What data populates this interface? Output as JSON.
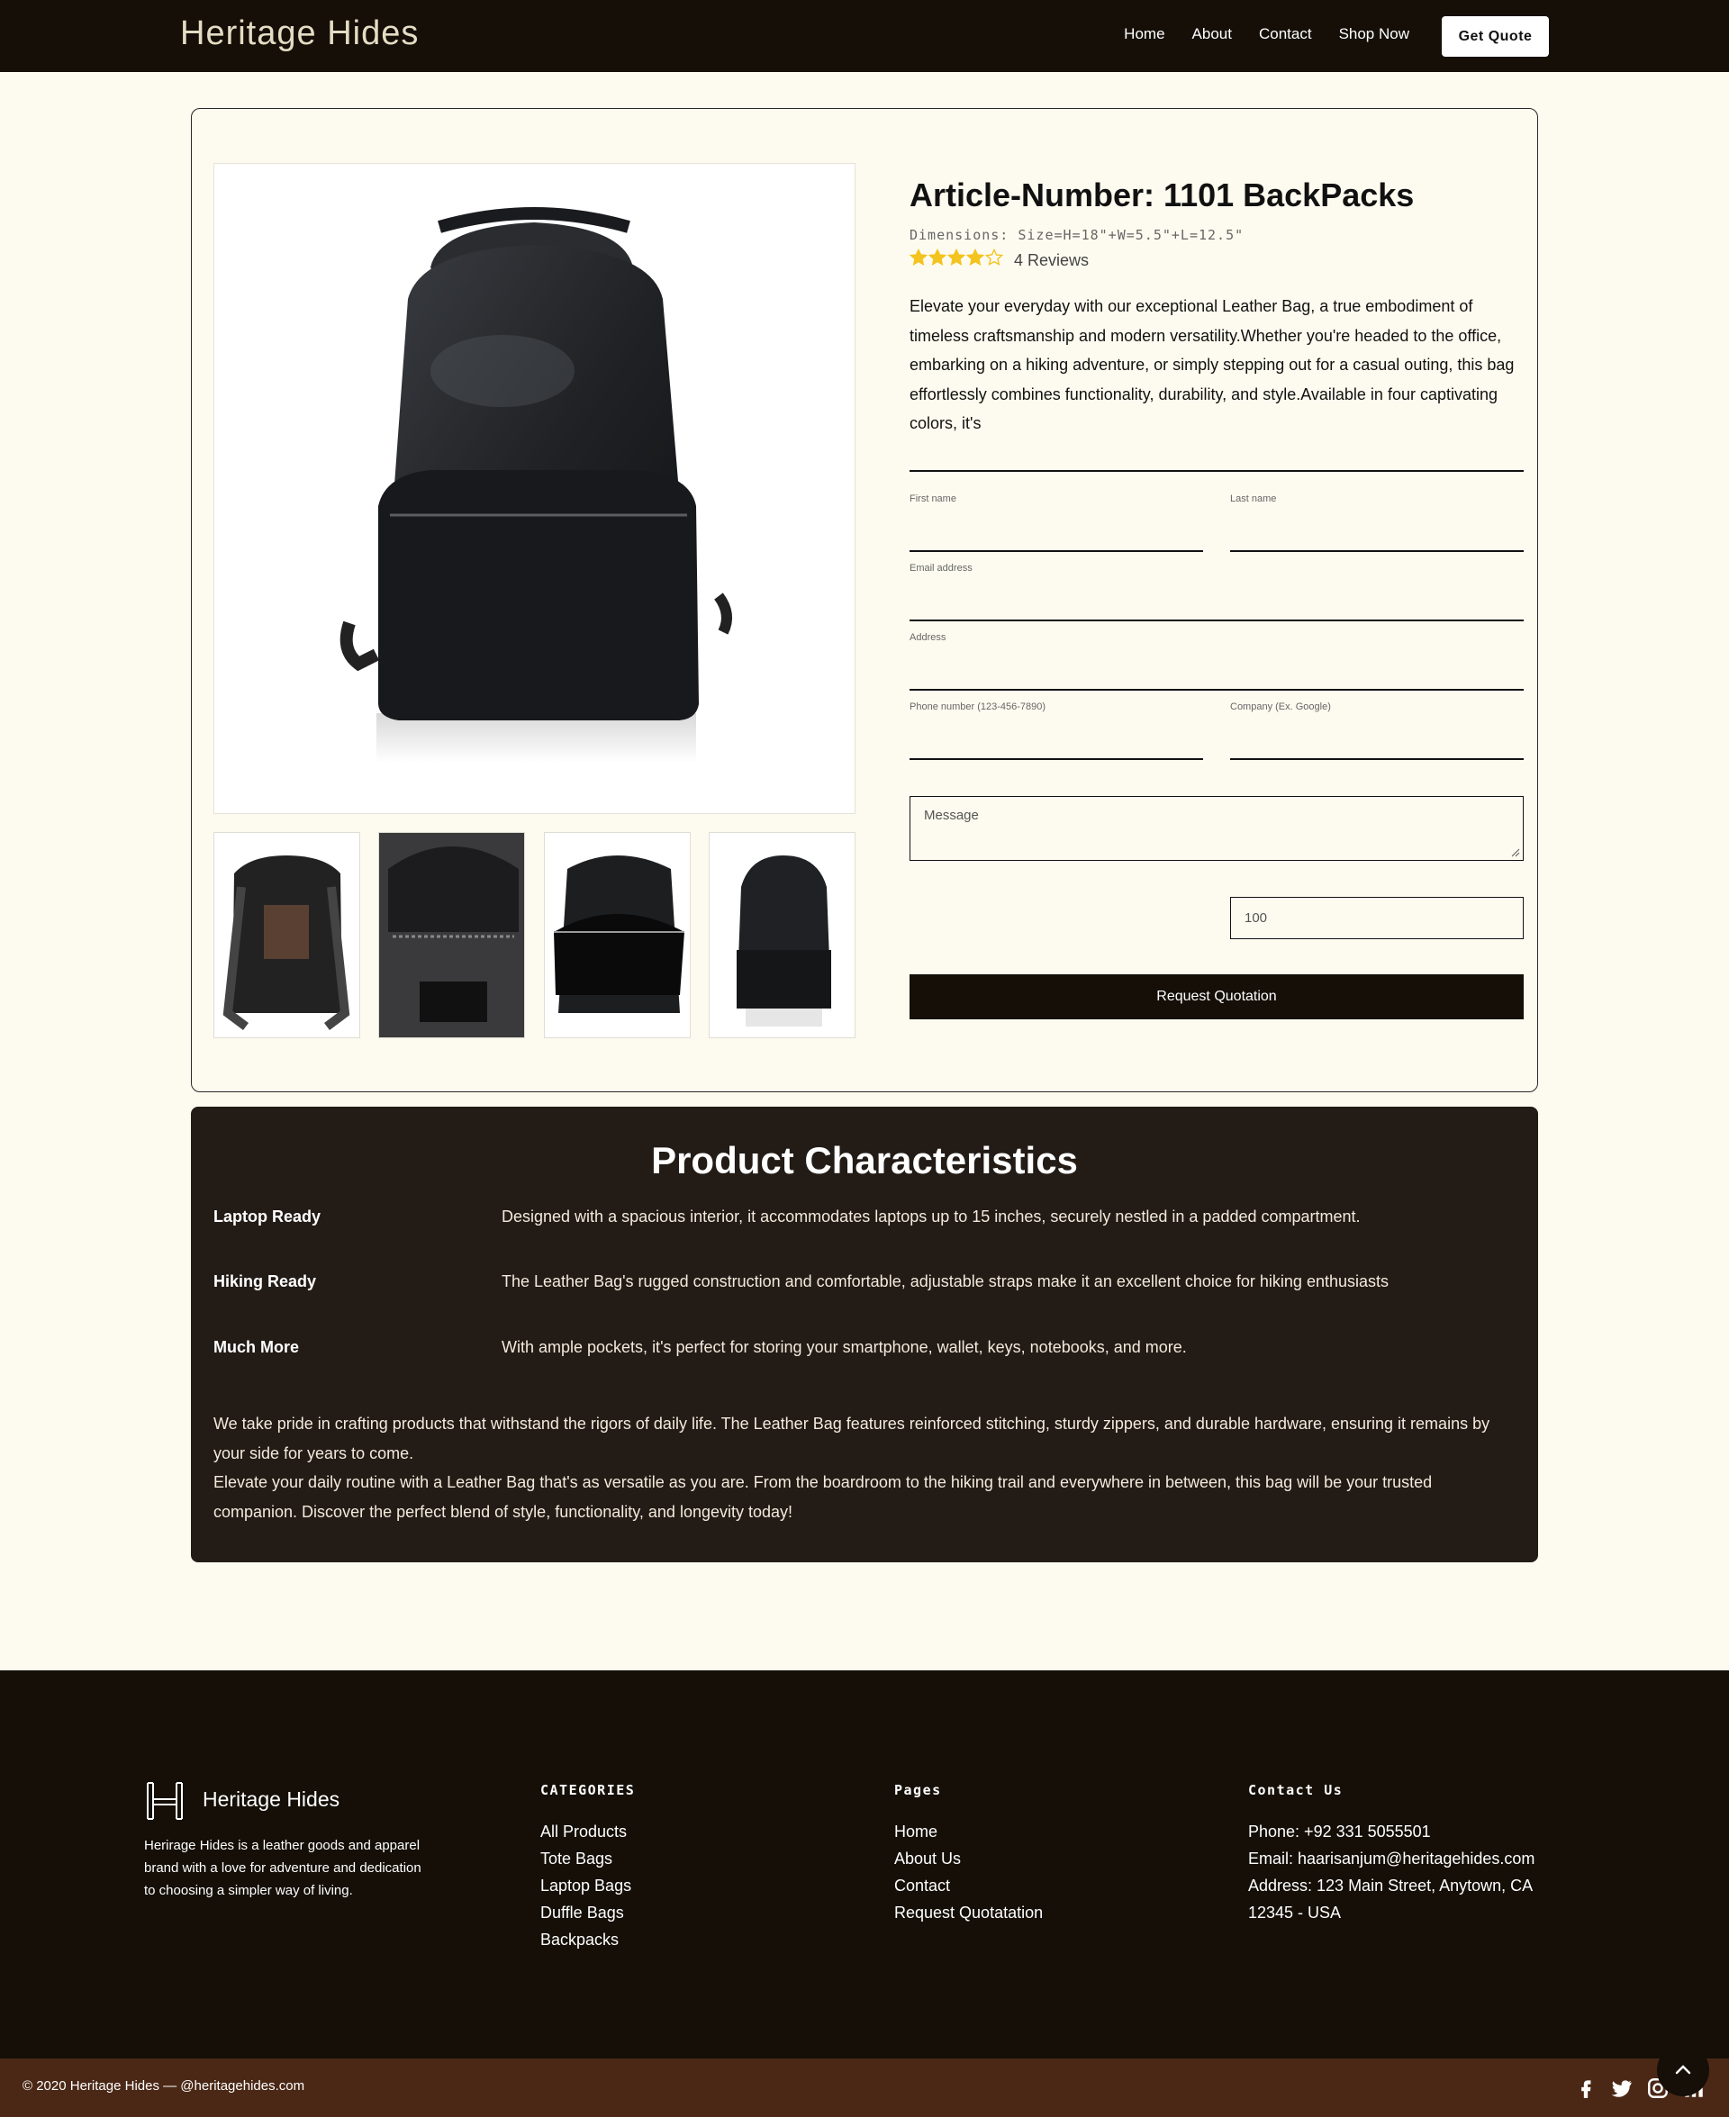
{
  "nav": {
    "brand": "Heritage Hides",
    "links": [
      "Home",
      "About",
      "Contact",
      "Shop Now"
    ],
    "cta": "Get Quote"
  },
  "product": {
    "title": "Article-Number: 1101 BackPacks",
    "dimensions": "Dimensions: Size=H=18\"+W=5.5\"+L=12.5\"",
    "rating": 4,
    "rating_max": 5,
    "reviews": "4 Reviews",
    "description": "Elevate your everyday with our exceptional Leather Bag, a true embodiment of timeless craftsmanship and modern versatility.Whether you're headed to the office, embarking on a hiking adventure, or simply stepping out for a casual outing, this bag effortlessly combines functionality, durability, and style.Available in four captivating colors, it's",
    "accent_star": "#f3c31f"
  },
  "form": {
    "first_name": "First name",
    "last_name": "Last name",
    "email": "Email address",
    "address": "Address",
    "phone": "Phone number (123-456-7890)",
    "company": "Company (Ex. Google)",
    "message_placeholder": "Message",
    "quantity": "100",
    "submit": "Request Quotation"
  },
  "characteristics": {
    "title": "Product Characteristics",
    "rows": [
      {
        "label": "Laptop Ready",
        "text": "Designed with a spacious interior, it accommodates laptops up to 15 inches, securely nestled in a padded compartment."
      },
      {
        "label": "Hiking Ready",
        "text": "The Leather Bag's rugged construction and comfortable, adjustable straps make it an excellent choice for hiking enthusiasts"
      },
      {
        "label": "Much More",
        "text": "With ample pockets, it's perfect for storing your smartphone, wallet, keys, notebooks, and more."
      }
    ],
    "para1": "We take pride in crafting products that withstand the rigors of daily life. The Leather Bag features reinforced stitching, sturdy zippers, and durable hardware, ensuring it remains by your side for years to come.",
    "para2": "Elevate your daily routine with a Leather Bag that's as versatile as you are. From the boardroom to the hiking trail and everywhere in between, this bag will be your trusted companion. Discover the perfect blend of style, functionality, and longevity today!"
  },
  "footer": {
    "brand": "Heritage Hides",
    "about": "Herirage Hides is a leather goods and apparel brand with a love for adventure and dedication to choosing a simpler way of living.",
    "categories_title": "CATEGORIES",
    "categories": [
      "All Products",
      "Tote Bags",
      "Laptop Bags",
      "Duffle Bags",
      "Backpacks"
    ],
    "pages_title": "Pages",
    "pages": [
      "Home",
      "About Us",
      "Contact",
      "Request Quotatation"
    ],
    "contact_title": "Contact Us",
    "contact": [
      "Phone: +92 331 5055501",
      "Email: haarisanjum@heritagehides.com",
      "Address: 123 Main Street, Anytown, CA",
      "12345 - USA"
    ],
    "copyright": "© 2020 Heritage Hides — @heritagehides.com",
    "socials": [
      "facebook-icon",
      "twitter-icon",
      "instagram-icon",
      "linkedin-icon"
    ]
  }
}
